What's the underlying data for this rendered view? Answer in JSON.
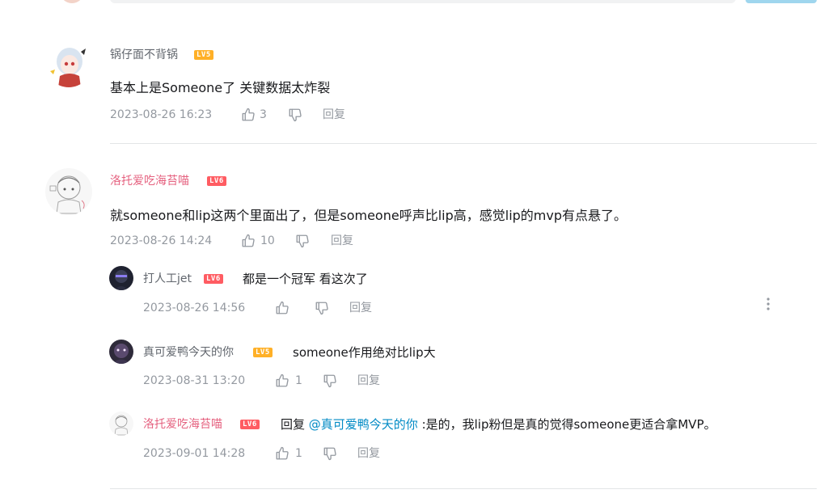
{
  "comments": [
    {
      "username": "锅仔面不背锅",
      "level": "LV5",
      "content": "基本上是Someone了 关键数据太炸裂",
      "time": "2023-08-26 16:23",
      "likes": "3",
      "reply_label": "回复"
    },
    {
      "username": "洛托爱吃海苔喵",
      "level": "LV6",
      "content": "就someone和lip这两个里面出了，但是someone呼声比lip高，感觉lip的mvp有点悬了。",
      "time": "2023-08-26 14:24",
      "likes": "10",
      "reply_label": "回复",
      "replies": [
        {
          "username": "打人工jet",
          "level": "LV6",
          "content": "都是一个冠军 看这次了",
          "time": "2023-08-26 14:56",
          "likes": "",
          "reply_label": "回复"
        },
        {
          "username": "真可爱鸭今天的你",
          "level": "LV5",
          "content": "someone作用绝对比lip大",
          "time": "2023-08-31 13:20",
          "likes": "1",
          "reply_label": "回复"
        },
        {
          "username": "洛托爱吃海苔喵",
          "level": "LV6",
          "reply_prefix": "回复",
          "mention": "@真可爱鸭今天的你",
          "content": " :是的，我lip粉但是真的觉得someone更适合拿MVP。",
          "time": "2023-09-01 14:28",
          "likes": "1",
          "reply_label": "回复"
        }
      ]
    }
  ],
  "icons": {
    "like": "thumbs-up-icon",
    "dislike": "thumbs-down-icon",
    "more": "more-vertical-icon"
  },
  "colors": {
    "vip_name": "#e5617f",
    "mention": "#008ac5",
    "lv5": "#ffb027",
    "lv6": "#ff5c62"
  }
}
